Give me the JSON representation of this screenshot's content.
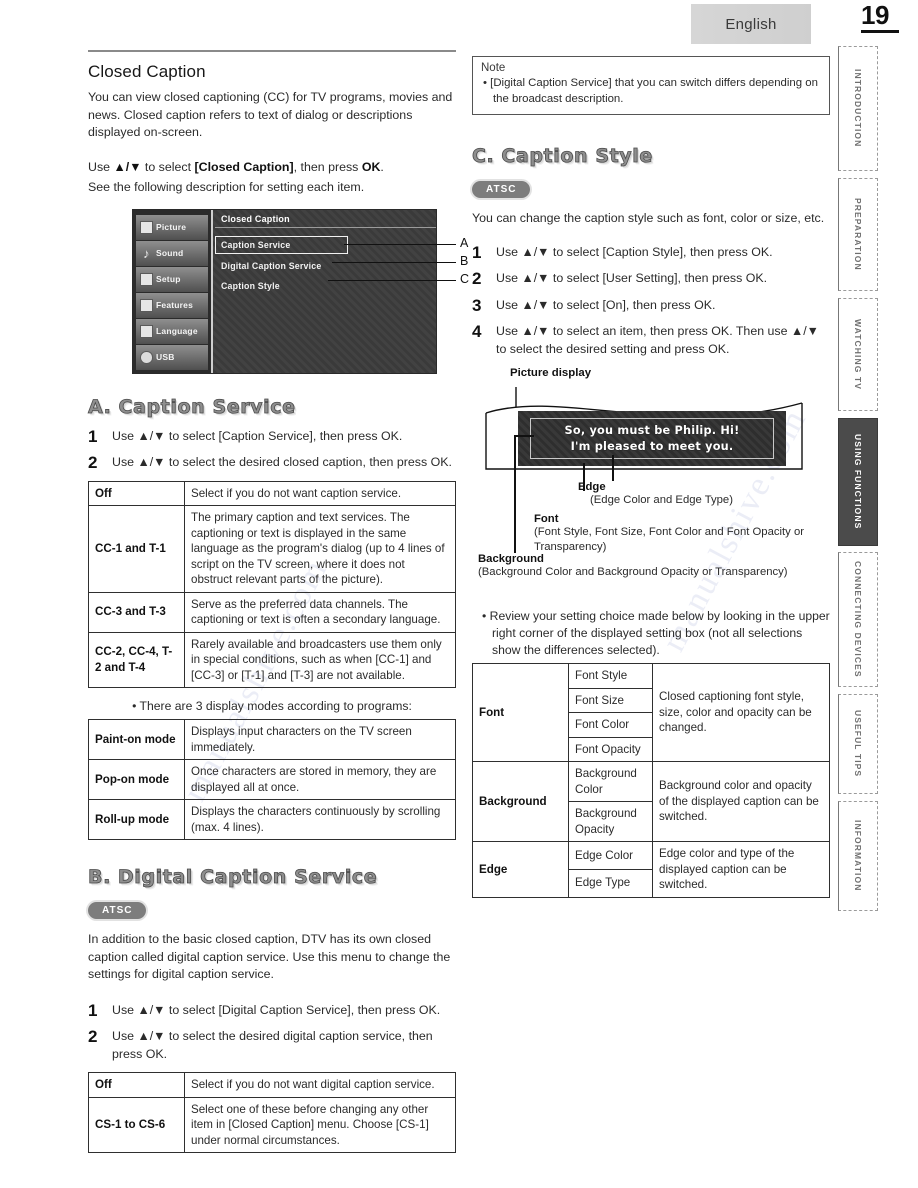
{
  "header": {
    "language": "English",
    "page_number": "19"
  },
  "side_tabs": [
    {
      "label": "INTRODUCTION",
      "active": false
    },
    {
      "label": "PREPARATION",
      "active": false
    },
    {
      "label": "WATCHING TV",
      "active": false
    },
    {
      "label": "USING FUNCTIONS",
      "active": true
    },
    {
      "label": "CONNECTING DEVICES",
      "active": false
    },
    {
      "label": "USEFUL TIPS",
      "active": false
    },
    {
      "label": "INFORMATION",
      "active": false
    }
  ],
  "left": {
    "section_title": "Closed Caption",
    "intro": "You can view closed captioning (CC) for TV programs, movies and news. Closed caption refers to text of dialog or descriptions displayed on-screen.",
    "use_line_1_pre": "Use ",
    "use_line_1_mid": " to select ",
    "use_line_1_bold": "[Closed Caption]",
    "use_line_1_post": ", then press ",
    "ok": "OK",
    "use_line_2": "See the following description for setting each item.",
    "osd": {
      "title": "Closed Caption",
      "menu_items": [
        {
          "label": "Picture",
          "icon": "picture-icon"
        },
        {
          "label": "Sound",
          "icon": "sound-icon"
        },
        {
          "label": "Setup",
          "icon": "setup-icon"
        },
        {
          "label": "Features",
          "icon": "features-icon"
        },
        {
          "label": "Language",
          "icon": "language-icon"
        },
        {
          "label": "USB",
          "icon": "usb-icon"
        }
      ],
      "rows": [
        {
          "label": "Caption Service",
          "callout": "A",
          "selected": true
        },
        {
          "label": "Digital Caption Service",
          "callout": "B",
          "selected": false
        },
        {
          "label": "Caption Style",
          "callout": "C",
          "selected": false
        }
      ]
    },
    "section_a": {
      "letter": "A.",
      "title": "Caption Service",
      "steps": [
        {
          "num": "1",
          "text": "Use ▲/▼ to select [Caption Service], then press OK."
        },
        {
          "num": "2",
          "text": "Use ▲/▼ to select the desired closed caption, then press OK."
        }
      ],
      "table": [
        {
          "key": "Off",
          "desc": "Select if you do not want caption service."
        },
        {
          "key": "CC-1 and T-1",
          "desc": "The primary caption and text services. The captioning or text is displayed in the same language as the program's dialog (up to 4 lines of script on the TV screen, where it does not obstruct relevant parts of the picture)."
        },
        {
          "key": "CC-3 and T-3",
          "desc": "Serve as the preferred data channels. The captioning or text is often a secondary language."
        },
        {
          "key": "CC-2, CC-4, T-2 and T-4",
          "desc": "Rarely available and broadcasters use them only in special conditions, such as when [CC-1] and [CC-3] or [T-1] and [T-3] are not available."
        }
      ],
      "modes_note": "• There are 3 display modes according to programs:",
      "modes_table": [
        {
          "key": "Paint-on mode",
          "desc": "Displays input characters on the TV screen immediately."
        },
        {
          "key": "Pop-on mode",
          "desc": "Once characters are stored in memory, they are displayed all at once."
        },
        {
          "key": "Roll-up mode",
          "desc": "Displays the characters continuously by scrolling (max. 4 lines)."
        }
      ]
    },
    "section_b": {
      "letter": "B.",
      "title": "Digital Caption Service",
      "badge": "ATSC",
      "intro": "In addition to the basic closed caption, DTV has its own closed caption called digital caption service. Use this menu to change the settings for digital caption service.",
      "steps": [
        {
          "num": "1",
          "text": "Use ▲/▼ to select [Digital Caption Service], then press OK."
        },
        {
          "num": "2",
          "text": "Use ▲/▼ to select the desired digital caption service, then press OK."
        }
      ],
      "table": [
        {
          "key": "Off",
          "desc": "Select if you do not want digital caption service."
        },
        {
          "key": "CS-1 to CS-6",
          "desc": "Select one of these before changing any other item in [Closed Caption] menu. Choose [CS-1] under normal circumstances."
        }
      ]
    }
  },
  "right": {
    "note": {
      "title": "Note",
      "item": "• [Digital Caption Service] that you can switch differs depending on the broadcast description."
    },
    "section_c": {
      "letter": "C.",
      "title": "Caption Style",
      "badge": "ATSC",
      "intro": "You can change the caption style such as font, color or size, etc.",
      "steps": [
        {
          "num": "1",
          "text": "Use ▲/▼ to select [Caption Style], then press OK."
        },
        {
          "num": "2",
          "text": "Use ▲/▼ to select [User Setting], then press OK."
        },
        {
          "num": "3",
          "text": "Use ▲/▼ to select [On], then press OK."
        },
        {
          "num": "4",
          "text": "Use ▲/▼ to select an item, then press OK. Then use ▲/▼ to select the desired setting and press OK."
        }
      ]
    },
    "diagram": {
      "picture_display_label": "Picture display",
      "caption_line_1": "So, you must be Philip. Hi!",
      "caption_line_2": "I'm pleased to meet you.",
      "edge_label": "Edge",
      "edge_sub": "(Edge Color and Edge Type)",
      "font_label": "Font",
      "font_sub": "(Font Style, Font Size, Font Color and Font Opacity or Transparency)",
      "background_label": "Background",
      "background_sub": "(Background Color and Background Opacity or Transparency)"
    },
    "review_note": "• Review your setting choice made below by looking in the upper right corner of the displayed setting box (not all selections show the differences selected).",
    "settings_table": [
      {
        "group": "Font",
        "items": [
          "Font Style",
          "Font Size",
          "Font Color",
          "Font Opacity"
        ],
        "desc": "Closed captioning font style, size, color and opacity can be changed."
      },
      {
        "group": "Background",
        "items": [
          "Background Color",
          "Background Opacity"
        ],
        "desc": "Background color and opacity of the displayed caption can be switched."
      },
      {
        "group": "Edge",
        "items": [
          "Edge Color",
          "Edge Type"
        ],
        "desc": "Edge color and type of the displayed caption can be switched."
      }
    ]
  },
  "watermark": {
    "text_1": "manualshive.com",
    "text_2": "manualshive.com"
  }
}
